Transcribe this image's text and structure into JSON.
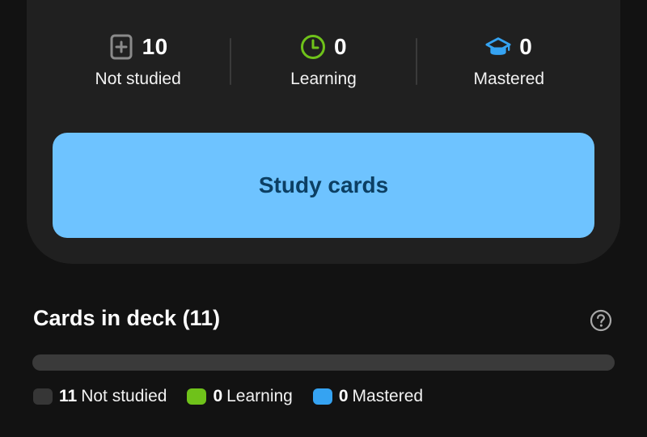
{
  "stats": [
    {
      "key": "not_studied",
      "icon": "card-plus-icon",
      "count": "10",
      "label": "Not studied",
      "color": "#8a8a8a"
    },
    {
      "key": "learning",
      "icon": "clock-icon",
      "count": "0",
      "label": "Learning",
      "color": "#6fc21a"
    },
    {
      "key": "mastered",
      "icon": "graduation-cap-icon",
      "count": "0",
      "label": "Mastered",
      "color": "#35a3f2"
    }
  ],
  "study_button": {
    "label": "Study cards",
    "bg": "#6ec3ff",
    "text_color": "#0c3f63"
  },
  "deck": {
    "title": "Cards in deck (11)",
    "help_icon": "question-circle-icon",
    "progress": {
      "not_studied": 11,
      "learning": 0,
      "mastered": 0,
      "total": 11
    },
    "legend": [
      {
        "count": "11",
        "label": "Not studied",
        "color": "#3a3a3a"
      },
      {
        "count": "0",
        "label": "Learning",
        "color": "#6fc21a"
      },
      {
        "count": "0",
        "label": "Mastered",
        "color": "#35a3f2"
      }
    ]
  }
}
